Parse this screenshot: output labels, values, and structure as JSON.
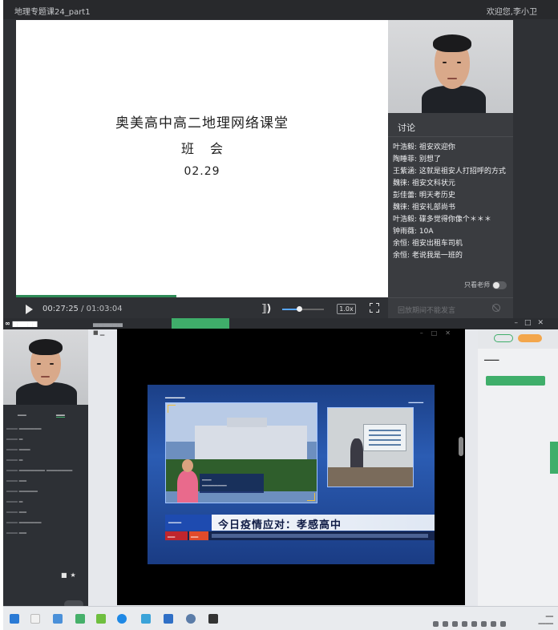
{
  "top_player": {
    "title": "地理专题课24_part1",
    "welcome": "欢迎您,李小卫",
    "slide": {
      "line1": "奥美高中高二地理网络课堂",
      "line2": "班会",
      "line3": "02.29"
    },
    "controls": {
      "current_time": "00:27:25",
      "separator": " / ",
      "duration": "01:03:04",
      "speed": "1.0x",
      "volume_fraction": 0.4,
      "progress_fraction": 0.43
    },
    "discussion": {
      "header": "讨论",
      "messages": [
        "叶浩毅: 祖安欢迎你",
        "陶睡菲: 别想了",
        "王紫涵: 这就是祖安人打招呼的方式",
        "魏徕: 祖安文科状元",
        "彭佳蕾: 明天考历史",
        "魏徕: 祖安礼部尚书",
        "叶浩毅: 碟多觉得你像个＊＊＊",
        "钟雨薇: 10A",
        "余恒: 祖安出租车司机",
        "余恒: 老说我是一班的"
      ],
      "only_teacher_label": "只看老师",
      "input_placeholder": "回放期间不能发言"
    }
  },
  "bottom_share": {
    "headline": "今日疫情应对：孝感高中"
  },
  "colors": {
    "accent_green": "#3fae6a",
    "dark_panel": "#2f3135",
    "volume_blue": "#58a6ff"
  }
}
